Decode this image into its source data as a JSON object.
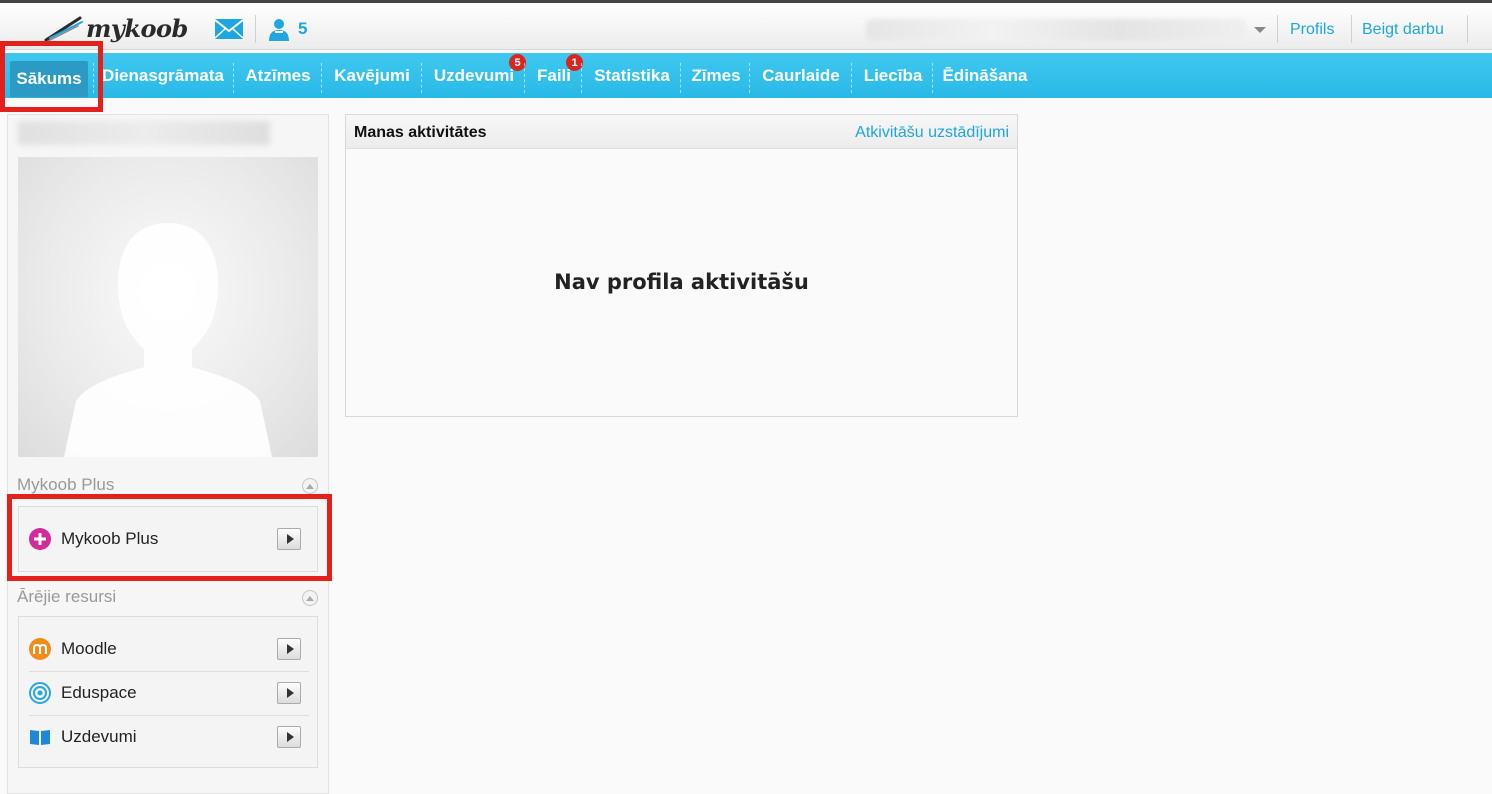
{
  "header": {
    "logo_text": "mykoob",
    "messages_icon": "envelope-icon",
    "users_icon": "users-icon",
    "users_count": "5",
    "profile_link": "Profils",
    "logout_link": "Beigt darbu"
  },
  "nav": {
    "tabs": [
      {
        "label": "Sākums",
        "active": true
      },
      {
        "label": "Dienasgrāmata"
      },
      {
        "label": "Atzīmes"
      },
      {
        "label": "Kavējumi"
      },
      {
        "label": "Uzdevumi",
        "badge": "5"
      },
      {
        "label": "Faili",
        "badge": "1"
      },
      {
        "label": "Statistika"
      },
      {
        "label": "Zīmes"
      },
      {
        "label": "Caurlaide"
      },
      {
        "label": "Liecība"
      },
      {
        "label": "Ēdināšana"
      }
    ]
  },
  "sidebar": {
    "plus_section": {
      "title": "Mykoob Plus",
      "items": [
        {
          "label": "Mykoob Plus",
          "icon": "plus-circle-icon"
        }
      ]
    },
    "external_section": {
      "title": "Ārējie resursi",
      "items": [
        {
          "label": "Moodle",
          "icon": "moodle-icon"
        },
        {
          "label": "Eduspace",
          "icon": "eduspace-icon"
        },
        {
          "label": "Uzdevumi",
          "icon": "book-icon"
        }
      ]
    }
  },
  "activities": {
    "title": "Manas aktivitātes",
    "settings_link": "Atkivitāšu uzstādījumi",
    "empty_text": "Nav profila aktivitāšu"
  },
  "colors": {
    "accent": "#1ea6e0",
    "nav_bg": "#33c0ec",
    "badge": "#d9261f",
    "highlight": "#e3201b"
  }
}
